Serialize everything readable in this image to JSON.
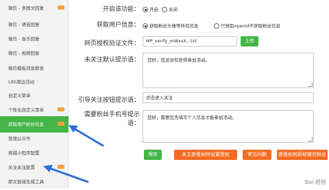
{
  "sidebar": {
    "items": [
      {
        "label": "微信 - 多图文回复",
        "active": false
      },
      {
        "label": "微信 - 语音回复",
        "active": false
      },
      {
        "label": "微信 - 音乐回复",
        "active": false
      },
      {
        "label": "微信 - 视频回复",
        "active": false
      },
      {
        "label": "微信模板消息群发",
        "active": false
      },
      {
        "label": "LBS周边活动",
        "active": false
      },
      {
        "label": "自定义菜单",
        "active": false
      },
      {
        "label": "个性化自定义菜单",
        "active": false
      },
      {
        "label": "获取用户粉丝信息",
        "active": true
      },
      {
        "label": "管理公众号",
        "active": false
      },
      {
        "label": "商城小程序配置",
        "active": false
      },
      {
        "label": "关注关注配置",
        "active": false
      },
      {
        "label": "原文链接生成工具",
        "active": false
      }
    ]
  },
  "form": {
    "enable_label": "开启该功能：",
    "enable_on": "开启",
    "enable_off": "关闭",
    "fetch_label": "获取用户信息：",
    "fetch_opt1": "获取粉丝头像等所有信息",
    "fetch_opt2": "只获取openid不获取粉丝信息",
    "verify_label": "网页授权验证文件：",
    "verify_value": "MP_verify_mWxsX...txt",
    "upload_button": "上传",
    "unfollow_label": "未关注默认提示语：",
    "unfollow_text": "您好，您还没有获得参加活动。",
    "guide_label": "引导关注按钮提示语：",
    "guide_text": "点击进入关注",
    "phone_label_1": "需要粉丝手机号提示",
    "phone_label_2": "语：",
    "phone_text": "您好，需要您先填写个人信息才能参加活动。"
  },
  "actions": {
    "save": "保存",
    "help_setup": "未主查看如何设置授权",
    "faq": "常见问题",
    "view_fans": "查看如何获取微信粉丝"
  },
  "watermark": "Bai 经验"
}
